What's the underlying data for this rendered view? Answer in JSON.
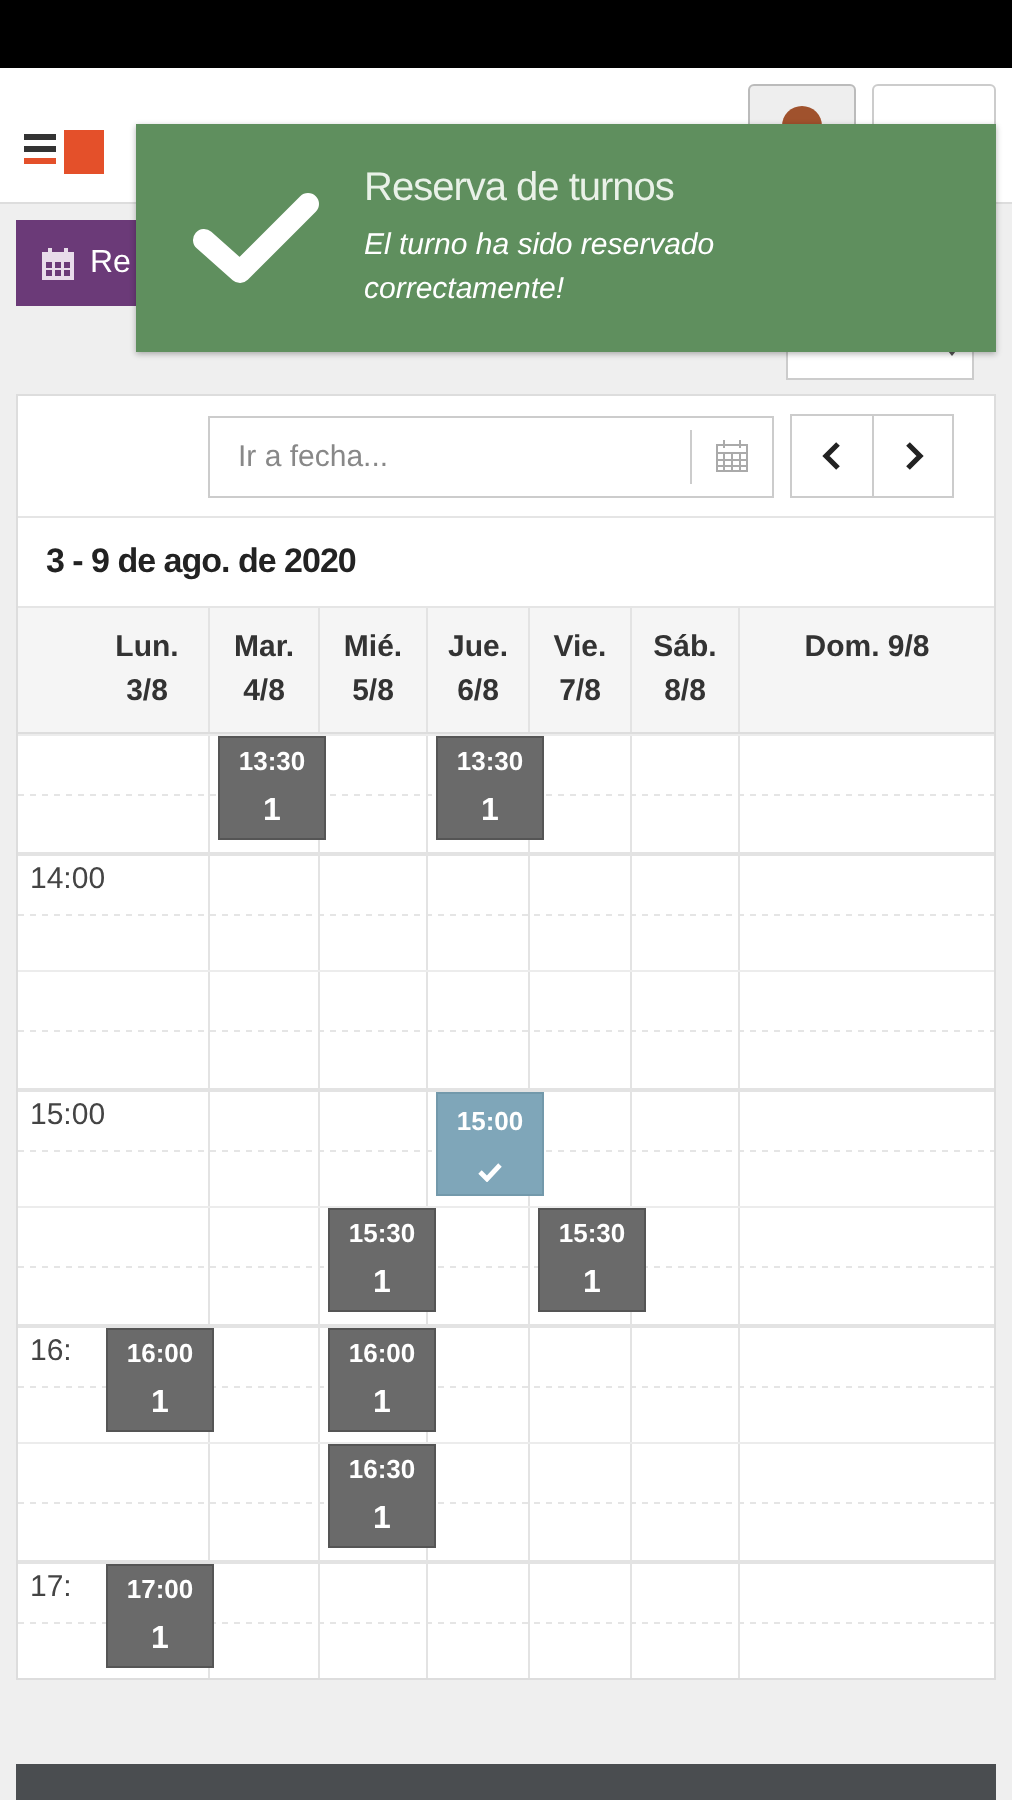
{
  "header": {
    "reserve_button": {
      "label": "Re"
    }
  },
  "toast": {
    "title": "Reserva de turnos",
    "message": "El turno ha sido reservado correctamente!"
  },
  "calendar": {
    "date_field": {
      "placeholder": "Ir a fecha..."
    },
    "range_title": "3 - 9 de ago. de 2020",
    "days": [
      {
        "label": "Lun. 3/8"
      },
      {
        "label": "Mar. 4/8"
      },
      {
        "label": "Mié. 5/8"
      },
      {
        "label": "Jue. 6/8"
      },
      {
        "label": "Vie. 7/8"
      },
      {
        "label": "Sáb. 8/8"
      },
      {
        "label": "Dom. 9/8"
      }
    ],
    "rows": [
      {
        "hour": false,
        "cells": [
          {
            "kind": "empty"
          },
          {
            "kind": "available",
            "time": "13:30",
            "count": "1"
          },
          {
            "kind": "empty"
          },
          {
            "kind": "available",
            "time": "13:30",
            "count": "1"
          },
          {
            "kind": "empty"
          },
          {
            "kind": "empty"
          },
          {
            "kind": "empty"
          }
        ]
      },
      {
        "hour": true,
        "time_label": "14:00",
        "cells": [
          {
            "kind": "empty"
          },
          {
            "kind": "empty"
          },
          {
            "kind": "empty"
          },
          {
            "kind": "empty"
          },
          {
            "kind": "empty"
          },
          {
            "kind": "empty"
          },
          {
            "kind": "empty"
          }
        ]
      },
      {
        "hour": false,
        "cells": [
          {
            "kind": "empty"
          },
          {
            "kind": "empty"
          },
          {
            "kind": "empty"
          },
          {
            "kind": "empty"
          },
          {
            "kind": "empty"
          },
          {
            "kind": "empty"
          },
          {
            "kind": "empty"
          }
        ]
      },
      {
        "hour": true,
        "time_label": "15:00",
        "cells": [
          {
            "kind": "empty"
          },
          {
            "kind": "empty"
          },
          {
            "kind": "empty"
          },
          {
            "kind": "reserved",
            "time": "15:00"
          },
          {
            "kind": "empty"
          },
          {
            "kind": "empty"
          },
          {
            "kind": "empty"
          }
        ]
      },
      {
        "hour": false,
        "cells": [
          {
            "kind": "empty"
          },
          {
            "kind": "empty"
          },
          {
            "kind": "available",
            "time": "15:30",
            "count": "1"
          },
          {
            "kind": "empty"
          },
          {
            "kind": "available",
            "time": "15:30",
            "count": "1"
          },
          {
            "kind": "empty"
          },
          {
            "kind": "empty"
          }
        ]
      },
      {
        "hour": true,
        "time_label": "16:",
        "cells": [
          {
            "kind": "available",
            "time": "16:00",
            "count": "1"
          },
          {
            "kind": "empty"
          },
          {
            "kind": "available",
            "time": "16:00",
            "count": "1"
          },
          {
            "kind": "empty"
          },
          {
            "kind": "empty"
          },
          {
            "kind": "empty"
          },
          {
            "kind": "empty"
          }
        ]
      },
      {
        "hour": false,
        "cells": [
          {
            "kind": "empty"
          },
          {
            "kind": "empty"
          },
          {
            "kind": "available",
            "time": "16:30",
            "count": "1"
          },
          {
            "kind": "empty"
          },
          {
            "kind": "empty"
          },
          {
            "kind": "empty"
          },
          {
            "kind": "empty"
          }
        ]
      },
      {
        "hour": true,
        "time_label": "17:",
        "cells": [
          {
            "kind": "available",
            "time": "17:00",
            "count": "1"
          },
          {
            "kind": "empty"
          },
          {
            "kind": "empty"
          },
          {
            "kind": "empty"
          },
          {
            "kind": "empty"
          },
          {
            "kind": "empty"
          },
          {
            "kind": "empty"
          }
        ]
      }
    ]
  }
}
